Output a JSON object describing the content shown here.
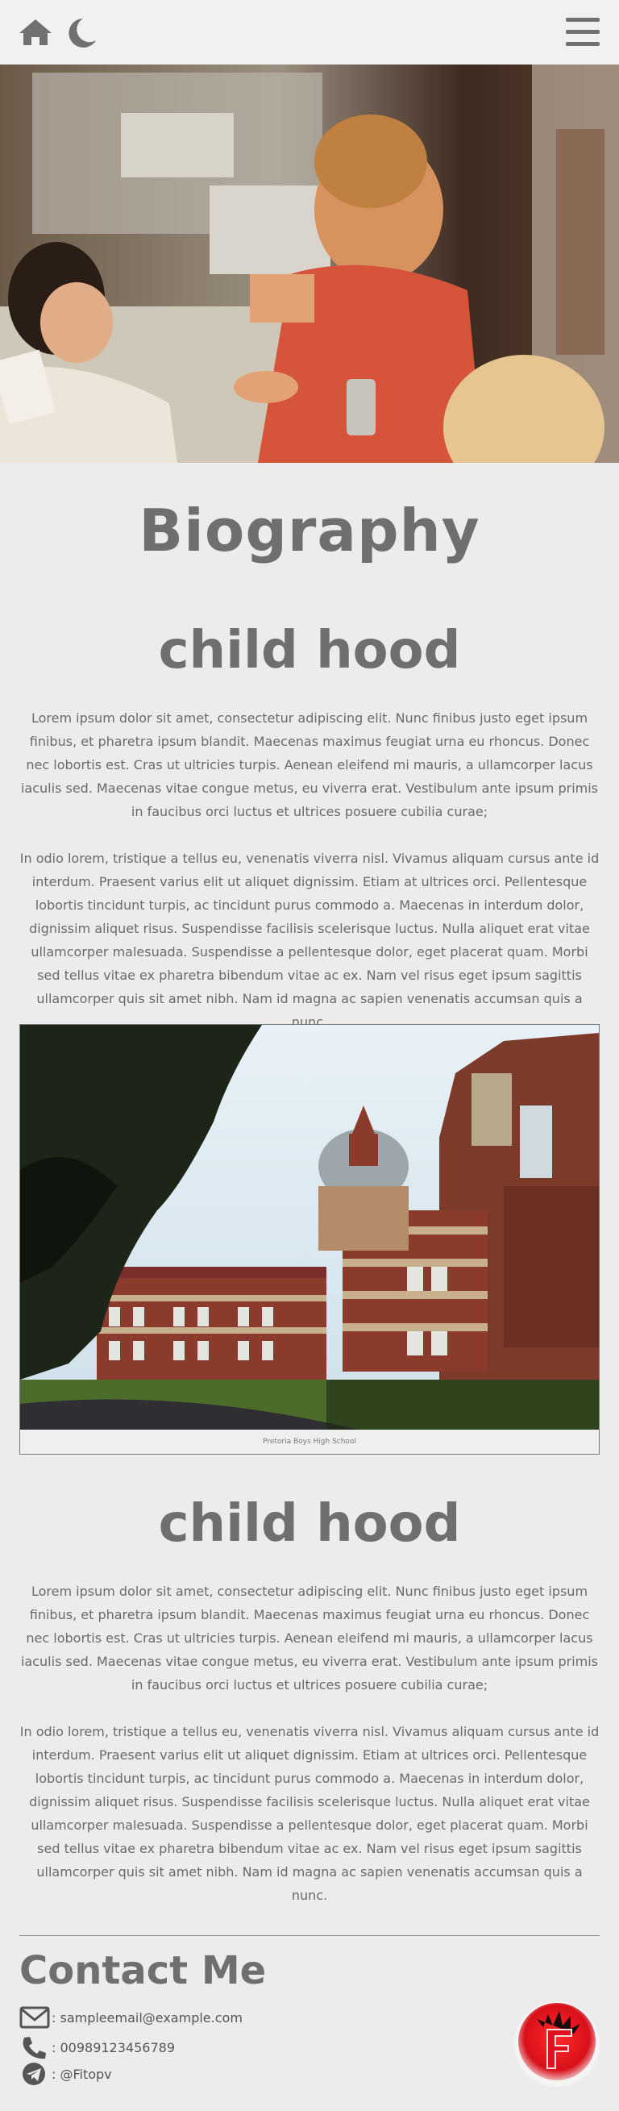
{
  "header": {
    "home_icon": "home-icon",
    "theme_icon": "moon-icon",
    "menu_icon": "hamburger-menu-icon"
  },
  "page": {
    "title": "Biography"
  },
  "sections": [
    {
      "heading": "child hood",
      "paragraphs": [
        "Lorem ipsum dolor sit amet, consectetur adipiscing elit. Nunc finibus justo eget ipsum finibus, et pharetra ipsum blandit. Maecenas maximus feugiat urna eu rhoncus. Donec nec lobortis est. Cras ut ultricies turpis. Aenean eleifend mi mauris, a ullamcorper lacus iaculis sed. Maecenas vitae congue metus, eu viverra erat. Vestibulum ante ipsum primis in faucibus orci luctus et ultrices posuere cubilia curae;",
        "In odio lorem, tristique a tellus eu, venenatis viverra nisl. Vivamus aliquam cursus ante id interdum. Praesent varius elit ut aliquet dignissim. Etiam at ultrices orci. Pellentesque lobortis tincidunt turpis, ac tincidunt purus commodo a. Maecenas in interdum dolor, dignissim aliquet risus. Suspendisse facilisis scelerisque luctus. Nulla aliquet erat vitae ullamcorper malesuada. Suspendisse a pellentesque dolor, eget placerat quam. Morbi sed tellus vitae ex pharetra bibendum vitae ac ex. Nam vel risus eget ipsum sagittis ullamcorper quis sit amet nibh. Nam id magna ac sapien venenatis accumsan quis a nunc."
      ]
    },
    {
      "heading": "child hood",
      "paragraphs": [
        "Lorem ipsum dolor sit amet, consectetur adipiscing elit. Nunc finibus justo eget ipsum finibus, et pharetra ipsum blandit. Maecenas maximus feugiat urna eu rhoncus. Donec nec lobortis est. Cras ut ultricies turpis. Aenean eleifend mi mauris, a ullamcorper lacus iaculis sed. Maecenas vitae congue metus, eu viverra erat. Vestibulum ante ipsum primis in faucibus orci luctus et ultrices posuere cubilia curae;",
        "In odio lorem, tristique a tellus eu, venenatis viverra nisl. Vivamus aliquam cursus ante id interdum. Praesent varius elit ut aliquet dignissim. Etiam at ultrices orci. Pellentesque lobortis tincidunt turpis, ac tincidunt purus commodo a. Maecenas in interdum dolor, dignissim aliquet risus. Suspendisse facilisis scelerisque luctus. Nulla aliquet erat vitae ullamcorper malesuada. Suspendisse a pellentesque dolor, eget placerat quam. Morbi sed tellus vitae ex pharetra bibendum vitae ac ex. Nam vel risus eget ipsum sagittis ullamcorper quis sit amet nibh. Nam id magna ac sapien venenatis accumsan quis a nunc."
      ]
    }
  ],
  "figure": {
    "caption": "Pretoria Boys High School"
  },
  "contact": {
    "title": "Contact Me",
    "email": ": sampleemail@example.com",
    "phone": ": 00989123456789",
    "telegram": ": @Fitopv"
  },
  "colors": {
    "background": "#ececec",
    "text": "#6a6a6a",
    "logo_red": "#e01020"
  }
}
